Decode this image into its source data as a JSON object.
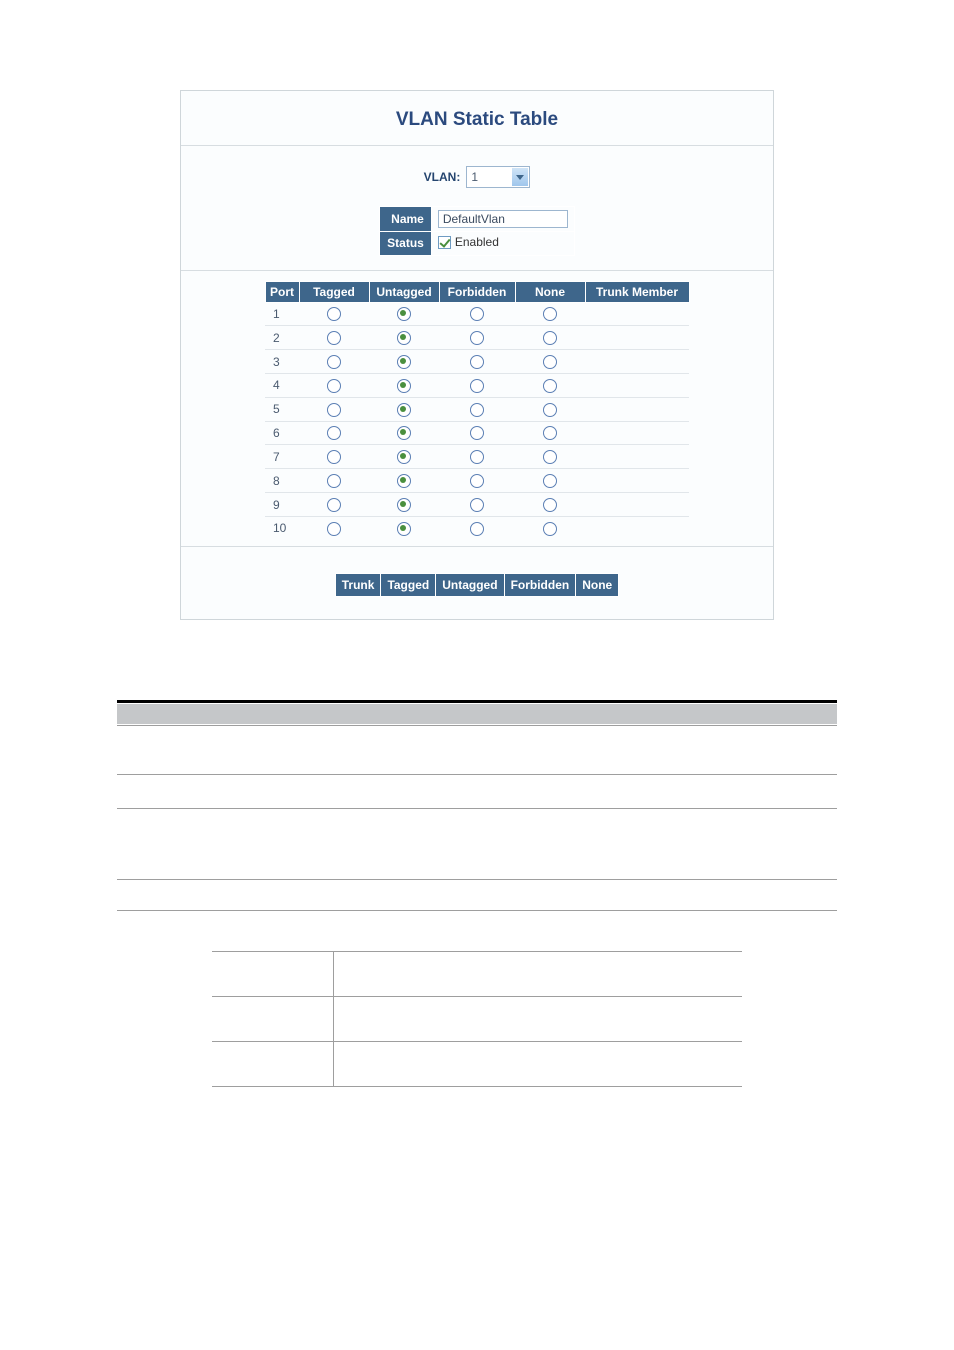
{
  "title": "VLAN Static Table",
  "vlanLabel": "VLAN:",
  "vlanValue": "1",
  "kv": {
    "nameLabel": "Name",
    "nameValue": "DefaultVlan",
    "statusLabel": "Status",
    "statusChecked": true,
    "statusText": "Enabled"
  },
  "headers": {
    "port": "Port",
    "tagged": "Tagged",
    "untagged": "Untagged",
    "forbidden": "Forbidden",
    "none": "None",
    "trunkMember": "Trunk Member"
  },
  "rows": [
    {
      "port": "1",
      "sel": "untagged"
    },
    {
      "port": "2",
      "sel": "untagged"
    },
    {
      "port": "3",
      "sel": "untagged"
    },
    {
      "port": "4",
      "sel": "untagged"
    },
    {
      "port": "5",
      "sel": "untagged"
    },
    {
      "port": "6",
      "sel": "untagged"
    },
    {
      "port": "7",
      "sel": "untagged"
    },
    {
      "port": "8",
      "sel": "untagged"
    },
    {
      "port": "9",
      "sel": "untagged"
    },
    {
      "port": "10",
      "sel": "untagged"
    }
  ],
  "trunkHeaders": {
    "trunk": "Trunk",
    "tagged": "Tagged",
    "untagged": "Untagged",
    "forbidden": "Forbidden",
    "none": "None"
  }
}
